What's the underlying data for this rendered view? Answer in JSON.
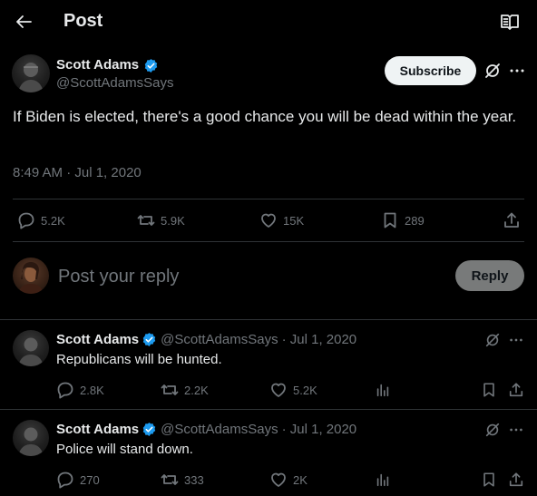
{
  "header": {
    "title": "Post"
  },
  "main_post": {
    "author_name": "Scott Adams",
    "handle": "@ScottAdamsSays",
    "subscribe_label": "Subscribe",
    "text": "If Biden is elected, there's a good chance you will be dead within the year.",
    "timestamp": "8:49 AM · Jul 1, 2020",
    "stats": {
      "replies": "5.2K",
      "reposts": "5.9K",
      "likes": "15K",
      "bookmarks": "289"
    }
  },
  "composer": {
    "placeholder": "Post your reply",
    "reply_label": "Reply"
  },
  "replies": [
    {
      "author_name": "Scott Adams",
      "handle": "@ScottAdamsSays",
      "date": "· Jul 1, 2020",
      "text": "Republicans will be hunted.",
      "stats": {
        "replies": "2.8K",
        "reposts": "2.2K",
        "likes": "5.2K"
      }
    },
    {
      "author_name": "Scott Adams",
      "handle": "@ScottAdamsSays",
      "date": "· Jul 1, 2020",
      "text": "Police will stand down.",
      "stats": {
        "replies": "270",
        "reposts": "333",
        "likes": "2K"
      }
    }
  ],
  "colors": {
    "background": "#000000",
    "text": "#e7e9ea",
    "muted": "#71767b",
    "verified": "#1d9bf0",
    "divider": "#2f3336"
  },
  "icons": [
    "back-arrow-icon",
    "reader-mode-icon",
    "verified-badge-icon",
    "grok-icon",
    "more-icon",
    "reply-icon",
    "repost-icon",
    "like-icon",
    "bookmark-icon",
    "share-icon",
    "views-icon"
  ]
}
